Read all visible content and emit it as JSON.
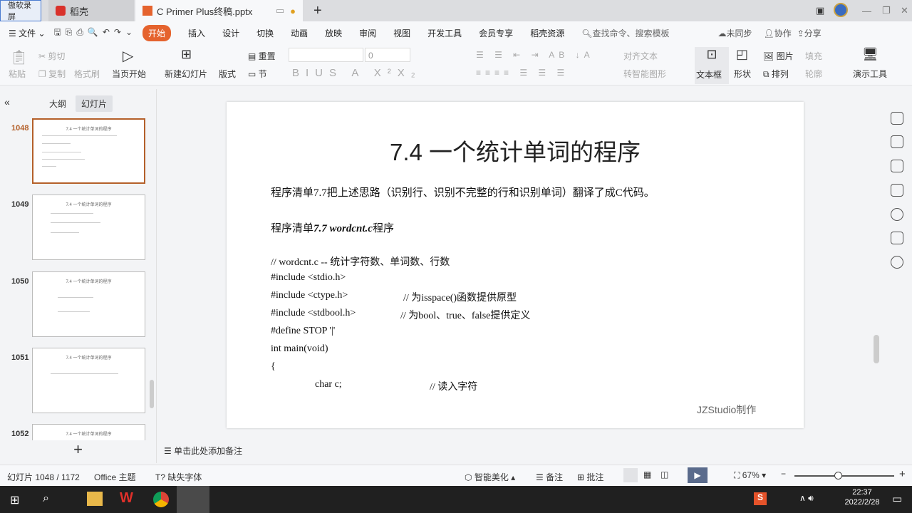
{
  "titlebar": {
    "recorder": "傲软录屏",
    "tabs": [
      {
        "label": "稻壳"
      },
      {
        "label": "C Primer  Plus终稿.pptx"
      }
    ],
    "new_tab": "+"
  },
  "menubar": {
    "file": "文件",
    "tabs": [
      "开始",
      "插入",
      "设计",
      "切换",
      "动画",
      "放映",
      "审阅",
      "视图",
      "开发工具",
      "会员专享",
      "稻壳资源"
    ],
    "search": "查找命令、搜索模板",
    "sync": "未同步",
    "collab": "协作",
    "share": "分享"
  },
  "ribbon": {
    "paste": "粘贴",
    "cut": "剪切",
    "copy": "复制",
    "format_painter": "格式刷",
    "play_current": "当页开始",
    "new_slide": "新建幻灯片",
    "layout": "版式",
    "section": "节",
    "reset": "重置",
    "font_size": "0",
    "align_text": "对齐文本",
    "smartart": "转智能图形",
    "textbox": "文本框",
    "shape": "形状",
    "picture": "图片",
    "fill": "填充",
    "arrange": "排列",
    "outline": "轮廓",
    "tools": "演示工具"
  },
  "panel": {
    "tab_outline": "大纲",
    "tab_slides": "幻灯片",
    "slides": [
      {
        "num": "1048",
        "title": "7.4 一个统计单词的程序"
      },
      {
        "num": "1049",
        "title": "7.4 一个统计单词的程序"
      },
      {
        "num": "1050",
        "title": "7.4 一个统计单词的程序"
      },
      {
        "num": "1051",
        "title": "7.4 一个统计单词的程序"
      },
      {
        "num": "1052",
        "title": "7.4 一个统计单词的程序"
      }
    ],
    "add": "+"
  },
  "slide": {
    "title": "7.4 一个统计单词的程序",
    "intro": "程序清单7.7把上述思路（识别行、识别不完整的行和识别单词）翻译了成C代码。",
    "listing_prefix": "程序清单",
    "listing_bold": "7.7 wordcnt.c",
    "listing_suffix": "程序",
    "code": [
      {
        "code": "// wordcnt.c -- 统计字符数、单词数、行数",
        "comment": ""
      },
      {
        "code": "#include <stdio.h>",
        "comment": ""
      },
      {
        "code": "#include <ctype.h>",
        "comment": "// 为isspace()函数提供原型"
      },
      {
        "code": "#include <stdbool.h>",
        "comment": "// 为bool、true、false提供定义"
      },
      {
        "code": "#define STOP '|'",
        "comment": ""
      },
      {
        "code": "int main(void)",
        "comment": ""
      },
      {
        "code": "{",
        "comment": ""
      },
      {
        "code": "char c;",
        "comment": "// 读入字符"
      }
    ],
    "watermark": "JZStudio制作"
  },
  "notes": {
    "placeholder": "单击此处添加备注"
  },
  "status": {
    "slide": "幻灯片 1048 / 1172",
    "theme": "Office 主题",
    "missing_font": "缺失字体",
    "beautify": "智能美化",
    "notes": "备注",
    "comment": "批注",
    "zoom": "67%",
    "zoom_fraction": 0.67
  },
  "taskbar": {
    "time": "22:37",
    "date": "2022/2/28"
  },
  "colors": {
    "accent": "#e5632e",
    "selected_border": "#b4602a"
  }
}
